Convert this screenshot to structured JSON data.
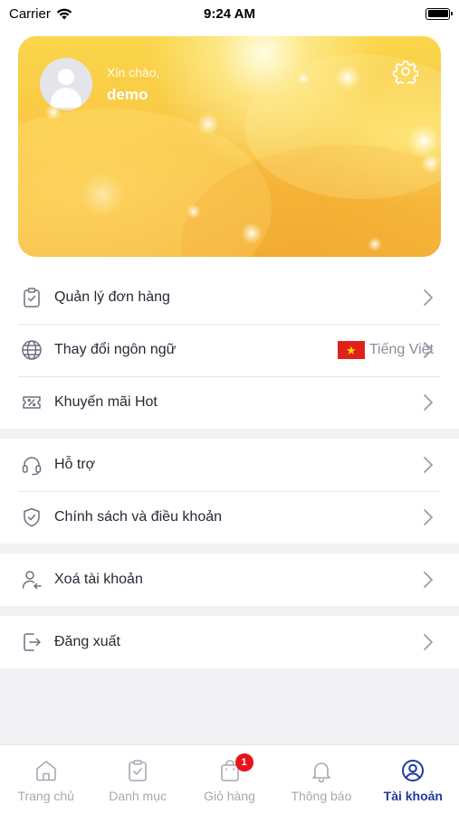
{
  "status_bar": {
    "carrier": "Carrier",
    "time": "9:24 AM"
  },
  "profile": {
    "greeting": "Xin chào,",
    "username": "demo"
  },
  "menu": {
    "group1": [
      {
        "label": "Quản lý đơn hàng",
        "icon": "order-clipboard-icon"
      },
      {
        "label": "Thay đổi ngôn ngữ",
        "icon": "globe-icon",
        "value": "Tiếng Việt",
        "flag": "vietnam-flag-icon"
      },
      {
        "label": "Khuyến mãi Hot",
        "icon": "ticket-icon"
      }
    ],
    "group2": [
      {
        "label": "Hỗ trợ",
        "icon": "headset-icon"
      },
      {
        "label": "Chính sách và điều khoản",
        "icon": "shield-check-icon"
      }
    ],
    "group3": [
      {
        "label": "Xoá tài khoản",
        "icon": "user-remove-icon"
      }
    ],
    "group4": [
      {
        "label": "Đăng xuất",
        "icon": "logout-icon"
      }
    ]
  },
  "tabbar": {
    "tabs": [
      {
        "label": "Trang chủ",
        "icon": "home-icon"
      },
      {
        "label": "Danh mục",
        "icon": "clipboard-check-icon"
      },
      {
        "label": "Giỏ hàng",
        "icon": "shopping-bag-icon",
        "badge": "1"
      },
      {
        "label": "Thông báo",
        "icon": "bell-icon"
      },
      {
        "label": "Tài khoản",
        "icon": "user-circle-icon",
        "active": true
      }
    ]
  },
  "colors": {
    "accent": "#1f3aa5",
    "badge": "#e8141b",
    "card_gold": "#f8c640"
  }
}
